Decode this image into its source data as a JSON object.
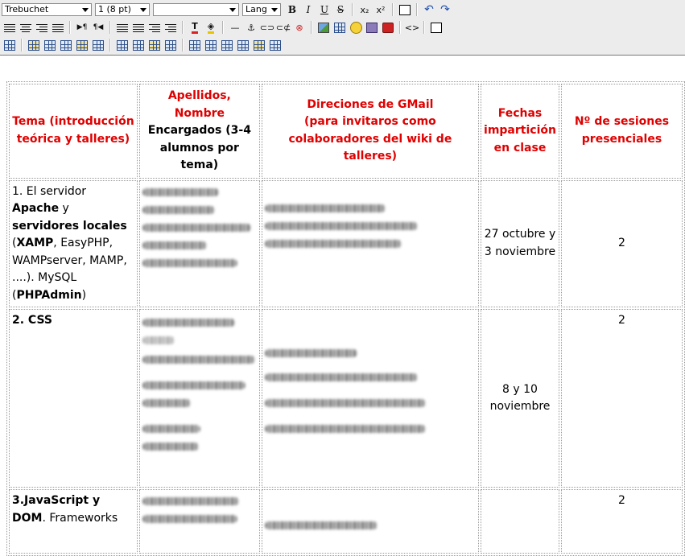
{
  "toolbar": {
    "font_family": "Trebuchet",
    "font_size": "1 (8 pt)",
    "heading": "",
    "lang": "Lang",
    "bold": "B",
    "italic": "I",
    "underline": "U",
    "strike": "S",
    "subscript": "x₂",
    "superscript": "x²",
    "ltr": "▶¶",
    "rtl": "¶◀",
    "hr": "—",
    "anchor": "⚓",
    "code": "<>"
  },
  "table": {
    "headers": [
      {
        "title": "Tema (introducción teórica y talleres)"
      },
      {
        "title": "Apellidos, Nombre",
        "sub": "Encargados (3-4 alumnos por tema)"
      },
      {
        "title": "Direciones de GMail",
        "sub_red": "(para invitaros como colaboradores del wiki de talleres)"
      },
      {
        "title": "Fechas impartición en clase"
      },
      {
        "title": "Nº de sesiones presenciales"
      }
    ],
    "rows": [
      {
        "tema_parts": [
          "1. El servidor ",
          "Apache",
          " y ",
          "servidores locales",
          " (",
          "XAMP",
          ", EasyPHP, WAMPserver, MAMP, ....). MySQL (",
          "PHPAdmin",
          ")"
        ],
        "fechas": "27 octubre y 3 noviembre",
        "sesiones": "2"
      },
      {
        "tema": "2. CSS",
        "fechas": "8 y 10 noviembre",
        "sesiones": "2"
      },
      {
        "tema_bold": "3.JavaScript y DOM",
        "tema_rest": ". Frameworks",
        "sesiones": "2"
      }
    ]
  }
}
